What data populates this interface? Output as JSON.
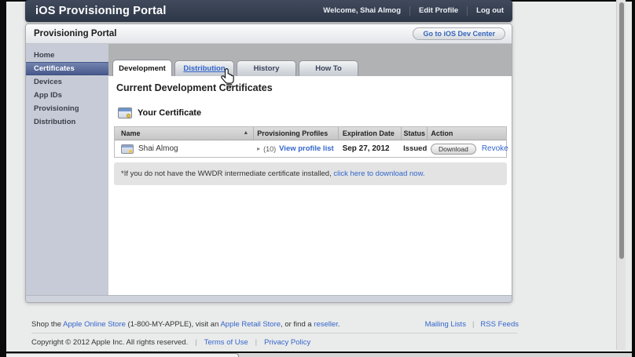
{
  "top_nav": {
    "title": "iOS Provisioning Portal",
    "welcome": "Welcome, Shai Almog",
    "edit_profile": "Edit Profile",
    "logout": "Log out"
  },
  "portal_header": {
    "title": "Provisioning Portal",
    "dev_center_button": "Go to iOS Dev Center"
  },
  "sidebar": {
    "items": [
      {
        "label": "Home",
        "selected": false
      },
      {
        "label": "Certificates",
        "selected": true
      },
      {
        "label": "Devices",
        "selected": false
      },
      {
        "label": "App IDs",
        "selected": false
      },
      {
        "label": "Provisioning",
        "selected": false
      },
      {
        "label": "Distribution",
        "selected": false
      }
    ]
  },
  "tabs": [
    {
      "label": "Development",
      "active": true
    },
    {
      "label": "Distribution",
      "active": false,
      "hovered": true
    },
    {
      "label": "History",
      "active": false
    },
    {
      "label": "How To",
      "active": false
    }
  ],
  "content": {
    "page_title": "Current Development Certificates",
    "section_title": "Your Certificate",
    "table": {
      "columns": [
        "Name",
        "Provisioning Profiles",
        "Expiration Date",
        "Status",
        "Action"
      ],
      "rows": [
        {
          "name": "Shai Almog",
          "profiles_count": "(10)",
          "profiles_link": "View profile list",
          "expiration": "Sep 27, 2012",
          "status": "Issued",
          "download_label": "Download",
          "revoke_label": "Revoke"
        }
      ]
    },
    "note_prefix": "*If you do not have the WWDR intermediate certificate installed, ",
    "note_link": "click here to download now."
  },
  "footer": {
    "shop_prefix": "Shop the ",
    "shop_link1": "Apple Online Store",
    "shop_mid1": " (1-800-MY-APPLE), visit an ",
    "shop_link2": "Apple Retail Store",
    "shop_mid2": ", or find a ",
    "shop_link3": "reseller",
    "shop_suffix": ".",
    "mailing_lists": "Mailing Lists",
    "rss_feeds": "RSS Feeds",
    "separator": "|",
    "copyright": "Copyright © 2012 Apple Inc. All rights reserved.",
    "terms": "Terms of Use",
    "privacy": "Privacy Policy"
  },
  "icons": {
    "sort_asc_glyph": "▲",
    "disclosure_glyph": "▸",
    "certificate_icon": "rect-with-blue-header-and-yellow-seal",
    "hand_cursor_icon": "mac-pointing-hand"
  },
  "colors": {
    "top_nav_bg": "#333d4f",
    "link_blue": "#3366cc",
    "sidebar_bg": "#c6cbd7",
    "sidebar_selected": "#53659a",
    "tabstrip_bg": "#b1b2b4",
    "note_bg": "#e3e3e3",
    "page_bg": "#eaebeb"
  }
}
